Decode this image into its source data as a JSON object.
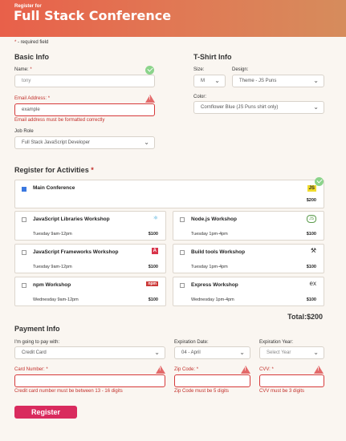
{
  "header": {
    "pretitle": "Register for",
    "title": "Full Stack Conference"
  },
  "required_note": {
    "star": "*",
    "text": "- required field"
  },
  "basic_info": {
    "heading": "Basic Info",
    "name_label": "Name:",
    "name_value": "tony",
    "email_label": "Email Address:",
    "email_value": "example",
    "email_error": "Email address must be formatted correctly",
    "job_label": "Job Role",
    "job_value": "Full Stack JavaScript Developer"
  },
  "tshirt": {
    "heading": "T-Shirt Info",
    "size_label": "Size:",
    "size_value": "M",
    "design_label": "Design:",
    "design_value": "Theme - JS Puns",
    "color_label": "Color:",
    "color_value": "Cornflower Blue (JS Puns shirt only)"
  },
  "activities": {
    "heading": "Register for Activities",
    "main": {
      "name": "Main Conference",
      "price": "$200",
      "checked": true,
      "icon": "JS"
    },
    "items": [
      {
        "name": "JavaScript Libraries Workshop",
        "time": "Tuesday 9am-12pm",
        "price": "$100",
        "icon": "react-icon"
      },
      {
        "name": "Node.js Workshop",
        "time": "Tuesday 1pm-4pm",
        "price": "$100",
        "icon": "nodejs-icon"
      },
      {
        "name": "JavaScript Frameworks Workshop",
        "time": "Tuesday 9am-12pm",
        "price": "$100",
        "icon": "angular-icon"
      },
      {
        "name": "Build tools Workshop",
        "time": "Tuesday 1pm-4pm",
        "price": "$100",
        "icon": "tools-icon"
      },
      {
        "name": "npm Workshop",
        "time": "Wednesday 9am-12pm",
        "price": "$100",
        "icon": "npm-icon"
      },
      {
        "name": "Express Workshop",
        "time": "Wednesday 1pm-4pm",
        "price": "$100",
        "icon": "express-icon"
      }
    ],
    "total": "Total:$200",
    "icon_text": {
      "js": "JS",
      "node": "JS",
      "angular": "A",
      "npm": "npm",
      "express": "ex",
      "react": "⚛",
      "tools": "⚒"
    }
  },
  "payment": {
    "heading": "Payment Info",
    "pay_label": "I'm going to pay with:",
    "pay_value": "Credit Card",
    "exp_date_label": "Expiration Date:",
    "exp_date_value": "04 - April",
    "exp_year_label": "Expiration Year:",
    "exp_year_value": "Select Year",
    "card_label": "Card Number:",
    "card_error": "Credit card number must be between 13 - 16 digits",
    "zip_label": "Zip Code:",
    "zip_error": "Zip Code must be 5 digits",
    "cvv_label": "CVV:",
    "cvv_error": "CVV must be 3 digits"
  },
  "submit_label": "Register",
  "colors": {
    "accent": "#d92b5e",
    "error": "#c2302b",
    "header_start": "#e8604a",
    "header_end": "#d68c5c"
  }
}
